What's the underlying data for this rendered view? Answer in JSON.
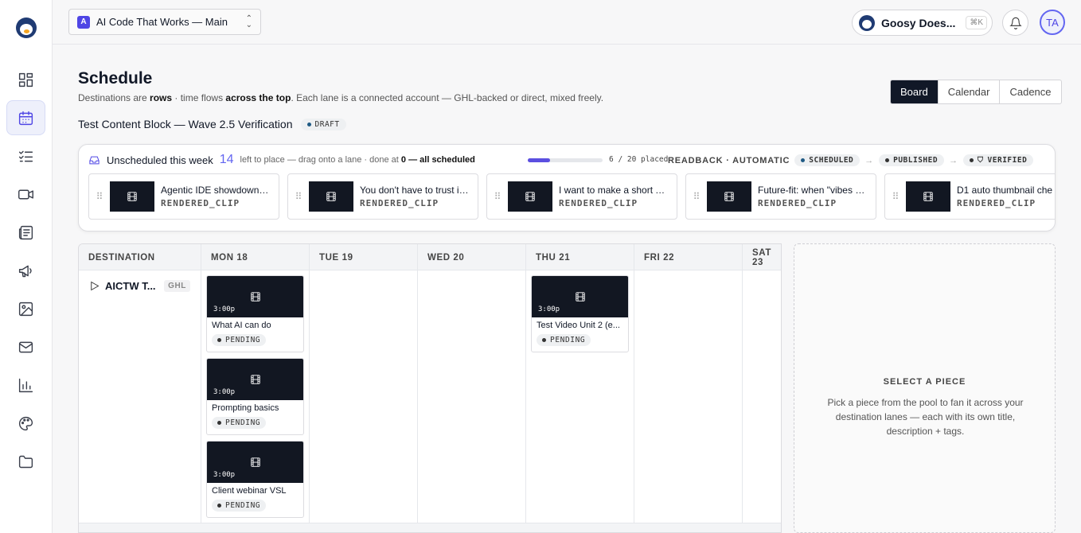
{
  "workspace": {
    "badge": "A",
    "name": "AI Code That Works — Main"
  },
  "account": {
    "name": "Goosy Does...",
    "shortcut": "⌘K"
  },
  "user": {
    "initials": "TA"
  },
  "sidebar": {
    "items": [
      {
        "icon": "dashboard-icon",
        "active": false
      },
      {
        "icon": "calendar-icon",
        "active": true
      },
      {
        "icon": "checklist-icon",
        "active": false
      },
      {
        "icon": "video-icon",
        "active": false
      },
      {
        "icon": "newspaper-icon",
        "active": false
      },
      {
        "icon": "megaphone-icon",
        "active": false
      },
      {
        "icon": "image-icon",
        "active": false
      },
      {
        "icon": "mail-icon",
        "active": false
      },
      {
        "icon": "bar-chart-icon",
        "active": false
      },
      {
        "icon": "palette-icon",
        "active": false
      },
      {
        "icon": "folder-icon",
        "active": false
      }
    ]
  },
  "page": {
    "title": "Schedule",
    "subtitle_1": "Destinations are ",
    "subtitle_b1": "rows",
    "subtitle_2": " · time flows ",
    "subtitle_b2": "across the top",
    "subtitle_3": ". Each lane is a connected account — GHL-backed or direct, mixed freely.",
    "block_name": "Test Content Block — Wave 2.5 Verification",
    "block_status": "DRAFT"
  },
  "views": [
    "Board",
    "Calendar",
    "Cadence"
  ],
  "pool": {
    "label": "Unscheduled this week",
    "count": "14",
    "hint_1": "left to place — drag onto a lane · done at ",
    "hint_b": "0 — all scheduled",
    "progress": 0.3,
    "progress_text": "6 / 20 placed",
    "readback": "READBACK · AUTOMATIC",
    "stages": [
      "SCHEDULED",
      "PUBLISHED",
      "VERIFIED"
    ],
    "clips": [
      {
        "title": "Agentic IDE showdown: ...",
        "type": "RENDERED_CLIP"
      },
      {
        "title": "You don't have to trust it. ...",
        "type": "RENDERED_CLIP"
      },
      {
        "title": "I want to make a short Yo...",
        "type": "RENDERED_CLIP"
      },
      {
        "title": "Future-fit: when \"vibes c...",
        "type": "RENDERED_CLIP"
      },
      {
        "title": "D1 auto thumbnail che",
        "type": "RENDERED_CLIP"
      }
    ]
  },
  "grid": {
    "headers": [
      "DESTINATION",
      "MON 18",
      "TUE 19",
      "WED 20",
      "THU 21",
      "FRI 22",
      "SAT 23"
    ],
    "destination": {
      "name": "AICTW T...",
      "tag": "GHL"
    },
    "cards": [
      {
        "time": "3:00p",
        "title": "What AI can do",
        "status": "PENDING"
      },
      {
        "time": "3:00p",
        "title": "Prompting basics",
        "status": "PENDING"
      },
      {
        "time": "3:00p",
        "title": "Client webinar VSL",
        "status": "PENDING"
      },
      {
        "time": "3:00p",
        "title": "Test Video Unit 2 (e...",
        "status": "PENDING"
      }
    ]
  },
  "empty": {
    "heading": "SELECT A PIECE",
    "body": "Pick a piece from the pool to fan it across your destination lanes — each with its own title, description + tags."
  }
}
